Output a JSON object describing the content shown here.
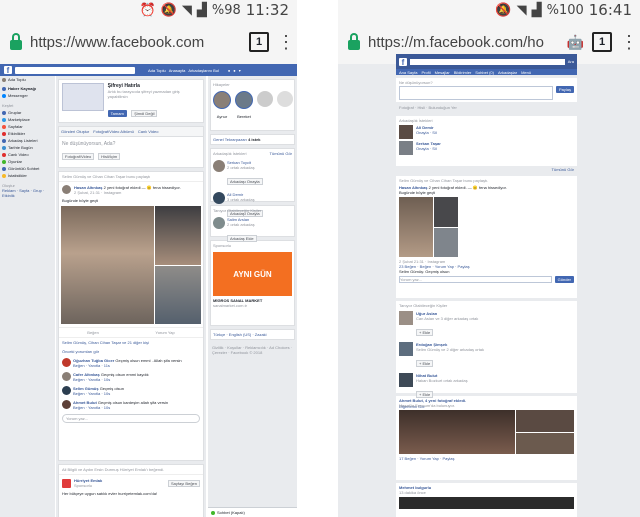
{
  "left": {
    "status": {
      "icons": [
        "alarm-icon",
        "mute-icon",
        "wifi-icon",
        "signal-icon"
      ],
      "battery": "%98",
      "time": "11:32"
    },
    "browser": {
      "url": "https://www.facebook.com",
      "tab_count": "1"
    },
    "topbar": {
      "name": "Ada Toplu",
      "home": "Anasayfa",
      "find_friends": "Arkadaşlarını Bul"
    },
    "sidebar": {
      "user": "Ada Toplu",
      "items": [
        {
          "label": "Haber Kaynağı",
          "color": "#4267b2"
        },
        {
          "label": "Messenger",
          "color": "#0084ff"
        },
        {
          "label": "Gruplar",
          "color": "#4267b2"
        },
        {
          "label": "Marketplace",
          "color": "#2e9ae6"
        },
        {
          "label": "Sayfalar",
          "color": "#f5533d"
        },
        {
          "label": "Etkinlikler",
          "color": "#e02e2e"
        },
        {
          "label": "Arkadaş Listeleri",
          "color": "#4267b2"
        },
        {
          "label": "Tarihte Bugün",
          "color": "#3b8ecf"
        },
        {
          "label": "Canlı Video",
          "color": "#e02e2e"
        },
        {
          "label": "Oyunlar",
          "color": "#42b72a"
        },
        {
          "label": "Görüntülü Sohbet",
          "color": "#4267b2"
        },
        {
          "label": "İstatistikler",
          "color": "#f7b928"
        }
      ],
      "section_kisayol": "Kısayollar",
      "section_kesfet": "Keşfet",
      "section_olustur": "Oluştur",
      "olustur_links": "Reklam · Sayfa · Grup · Etkinlik"
    },
    "security": {
      "title": "Şifreyi Hatırla",
      "text": "Artık bu tarayıcıda şifreyi yazmadan giriş yapabilirsin",
      "ok": "Tamam",
      "not_now": "Şimdi Değil"
    },
    "composer": {
      "tabs": [
        "Gönderi Oluştur",
        "Fotoğraf/Video Albümü",
        "Canlı Video"
      ],
      "placeholder": "Ne düşünüyorsun, Ada?",
      "photo": "Fotoğraf/Video",
      "feeling": "Hisli/İçim"
    },
    "post1": {
      "header": "Selim Gümüş ve Cihan Cihan Taşar bunu paylaştı",
      "author": "Hasan Altınkaş",
      "tag": "2 yeni fotoğraf ekledi — 😐 fena hissediyor.",
      "date": "2 Şubat, 21:31 · Instagram",
      "caption": "Bugünde böyle geçti",
      "actions": [
        "Beğen",
        "Yorum Yap"
      ],
      "likes": "Selim Gümüş, Cihan Cihan Taşar ve 21 diğer kişi",
      "comments_header": "Önceki yorumları gör",
      "comments": [
        {
          "name": "Oğuzhan Tuğba Gicer",
          "text": "Geçmiş olsun emmi . Allah şifa versin",
          "meta": "Beğen · Yanıtla · 11s"
        },
        {
          "name": "Cafer Altınkaş",
          "text": "Geçmiş olsun emmi kaydık",
          "meta": "Beğen · Yanıtla · 10s"
        },
        {
          "name": "Selim Gümüş",
          "text": "Geçmiş olsun",
          "meta": "Beğen · Yanıtla · 10s"
        },
        {
          "name": "Ahmet Bulut",
          "text": "Geçmiş olsun kardeşim allah şifa versin",
          "meta": "Beğen · Yanıtla · 10s"
        }
      ],
      "write_comment": "Yorum yaz..."
    },
    "post2": {
      "header": "Ali Bilgili ve Aydın Ersin Durmuş Hürriyet Emlak'ı beğendi.",
      "page": "Hürriyet Emlak",
      "sponsored": "Sponsorlu",
      "like_btn": "Sayfayı Beğen",
      "text": "Her bütçeye uygun satılık evler hurriyetemlak.com'da!"
    },
    "right": {
      "stories": "Hikayeler",
      "story_names": [
        "Aynur",
        "Bereket"
      ],
      "tekrar": "Genel Tekrarpazarı",
      "tekrar_count": "4 istek",
      "requests_title": "Arkadaşlık İstekleri",
      "see_all": "Tümünü Gör",
      "requests": [
        {
          "name": "Serkan Toycit",
          "meta": "2 ortak arkadaş",
          "btn": "Arkadaşı Onayla"
        },
        {
          "name": "Ali Demir",
          "meta": "3 ortak arkadaş",
          "btn": "Arkadaşı Onayla"
        }
      ],
      "pymk_title": "Tanıyor Olabileceğin Kişiler",
      "pymk": {
        "name": "Salim Arslan",
        "meta": "2 ortak arkadaş",
        "btn": "Arkadaş Ekle"
      },
      "sponsored": "Sponsorlu",
      "ad_title": "AYNI GÜN",
      "ad_name": "MİGROS SANAL MARKET",
      "ad_url": "sanalmarket.com.tr",
      "lang": "Türkçe · English (US) · Zazaki",
      "footer": "Gizlilik · Koşullar · Reklamcılık · Ad Choices · Çerezler · Facebook © 2018",
      "chat": "Sohbet (Kapalı)"
    }
  },
  "right_phone": {
    "status": {
      "icons": [
        "mute-icon",
        "wifi-icon",
        "signal-icon"
      ],
      "battery": "%100",
      "time": "16:41"
    },
    "browser": {
      "url": "https://m.facebook.com/ho",
      "tab_count": "1"
    },
    "topnav": [
      "Ana Sayfa",
      "Profil",
      "Mesajlar",
      "Bildirimler",
      "Sohbet (0)",
      "Arkadaşlar",
      "Menü"
    ],
    "composer_label": "Ne düşünüyorsun?",
    "share_btn": "Paylaş",
    "photo_row": "Fotoğraf · Hisli · Bulunduğun Yer",
    "requests": {
      "title": "Arkadaşlık İstekleri",
      "items": [
        {
          "name": "Ali Demir",
          "meta": "Onayla · Sil"
        },
        {
          "name": "Serkan Taşar",
          "meta": "Onayla · Sil"
        }
      ],
      "see_all": "Tümünü Gör"
    },
    "post": {
      "header": "Selim Gümüş ve Cihan Cihan Taşar bunu paylaştı.",
      "author": "Hasan Altınkaş",
      "tag": "2 yeni fotoğraf ekledi. — 😐 fena hissediyor.",
      "caption": "Bugünde böyle geçti",
      "meta": "2 Şubat 21:31 · Instagram",
      "actions": "23 Beğen · Beğen · Yorum Yap · Paylaş",
      "comment": "Selim Gümüş: Geçmiş olsun",
      "write": "Yorum yaz...",
      "send": "Gönder"
    },
    "pymk": {
      "title": "Tanıyor Olabileceğin Kişiler",
      "items": [
        {
          "name": "Uğur Aslan",
          "meta": "Can Aslan ve 3 diğer arkadaş ortak",
          "btn": "+ Ekle"
        },
        {
          "name": "Erdoğan Şimşek",
          "meta": "Selim Gümüş ve 2 diğer arkadaş ortak",
          "btn": "+ Ekle"
        },
        {
          "name": "Nihat Bulut",
          "meta": "Hakan Bozkurt ortak arkadaş",
          "btn": "+ Ekle"
        }
      ],
      "more": "Diğerlerini Gör"
    },
    "post2": {
      "header": "Ahmet Bulut, 4 yeni fotoğraf ekledi.",
      "tag": "Mezat'ta Erzurum'da bulunuyor.",
      "actions": "17 Beğen · Yorum Yap · Paylaş"
    },
    "post3": {
      "header": "Mehmet bulgurlu",
      "date": "13 dakika önce"
    }
  }
}
